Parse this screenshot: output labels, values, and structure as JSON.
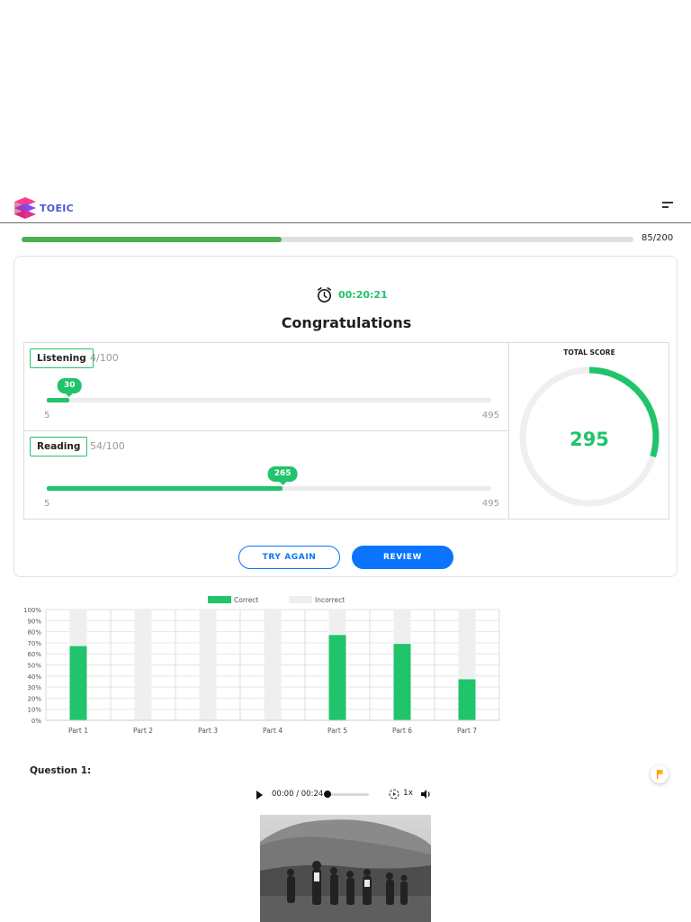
{
  "header": {
    "logo_text": "TOEIC",
    "menu_icon": "hamburger-icon"
  },
  "progress": {
    "answered": 85,
    "total": 200,
    "label": "85/200"
  },
  "result": {
    "timer_icon": "alarm-clock-icon",
    "elapsed": "00:20:21",
    "title": "Congratulations",
    "listening": {
      "label": "Listening",
      "count": "4/100",
      "score": 30,
      "score_label": "30",
      "min": 5,
      "max": 495,
      "min_label": "5",
      "max_label": "495"
    },
    "reading": {
      "label": "Reading",
      "count": "54/100",
      "score": 265,
      "score_label": "265",
      "min": 5,
      "max": 495,
      "min_label": "5",
      "max_label": "495"
    },
    "total": {
      "label": "TOTAL SCORE",
      "score": 295,
      "score_label": "295",
      "max": 990
    },
    "try_again_label": "TRY AGAIN",
    "review_label": "REVIEW"
  },
  "chart_data": {
    "type": "bar",
    "categories": [
      "Part 1",
      "Part 2",
      "Part 3",
      "Part 4",
      "Part 5",
      "Part 6",
      "Part 7"
    ],
    "series": [
      {
        "name": "Correct",
        "values": [
          67,
          0,
          0,
          0,
          77,
          69,
          37
        ]
      },
      {
        "name": "Incorrect",
        "values": [
          33,
          100,
          100,
          100,
          23,
          31,
          63
        ]
      }
    ],
    "stacked": true,
    "ylim": [
      0,
      100
    ],
    "yticks": [
      "0%",
      "10%",
      "20%",
      "30%",
      "40%",
      "50%",
      "60%",
      "70%",
      "80%",
      "90%",
      "100%"
    ],
    "grid": true,
    "legend": "top",
    "colors": {
      "Correct": "#1fc46b",
      "Incorrect": "#efefef"
    }
  },
  "question": {
    "title": "Question 1:",
    "flag_icon": "flag-icon",
    "audio": {
      "time": "00:00 / 00:24",
      "rate": "1x"
    }
  },
  "colors": {
    "accent": "#1fc46b",
    "primary": "#0a74ff",
    "progress": "#4caf50"
  }
}
